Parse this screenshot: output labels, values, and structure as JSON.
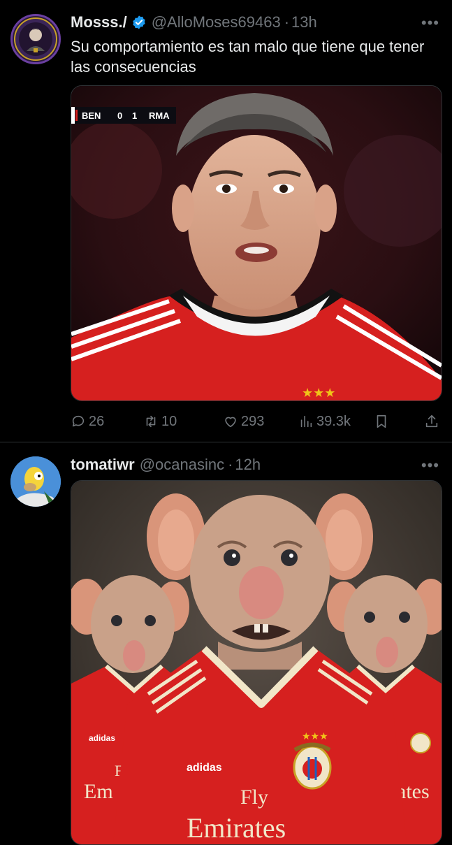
{
  "posts": [
    {
      "name": "Mosss./",
      "handle": "@AlloMoses69463",
      "time": "13h",
      "separator": "·",
      "verified": true,
      "text": "Su comportamiento es tan malo que tiene que tener las consecuencias",
      "media": {
        "scoreboard": {
          "home": "BEN",
          "home_score": "0",
          "away_score": "1",
          "away": "RMA"
        }
      },
      "stats": {
        "replies": "26",
        "reposts": "10",
        "likes": "293",
        "views": "39.3k"
      }
    },
    {
      "name": "tomatiwr",
      "handle": "@ocanasinc",
      "time": "12h",
      "separator": "·",
      "verified": false,
      "media": {
        "jersey_brand": "adidas",
        "sponsor_top": "Fly",
        "sponsor_bottom": "Emirates",
        "left_sponsor_fragment": "Em",
        "right_sponsor_fragment": "ates",
        "right_sponsor_fragment_top": "y",
        "left_sponsor_fragment_top": "F"
      }
    }
  ],
  "icons": [
    "more-icon",
    "verified-icon",
    "reply-icon",
    "repost-icon",
    "like-icon",
    "views-icon",
    "bookmark-icon",
    "share-icon"
  ],
  "colors": {
    "background": "#000000",
    "secondary_text": "#71767b",
    "verified_blue": "#1d9bf0",
    "benfica_red": "#d6201f"
  }
}
